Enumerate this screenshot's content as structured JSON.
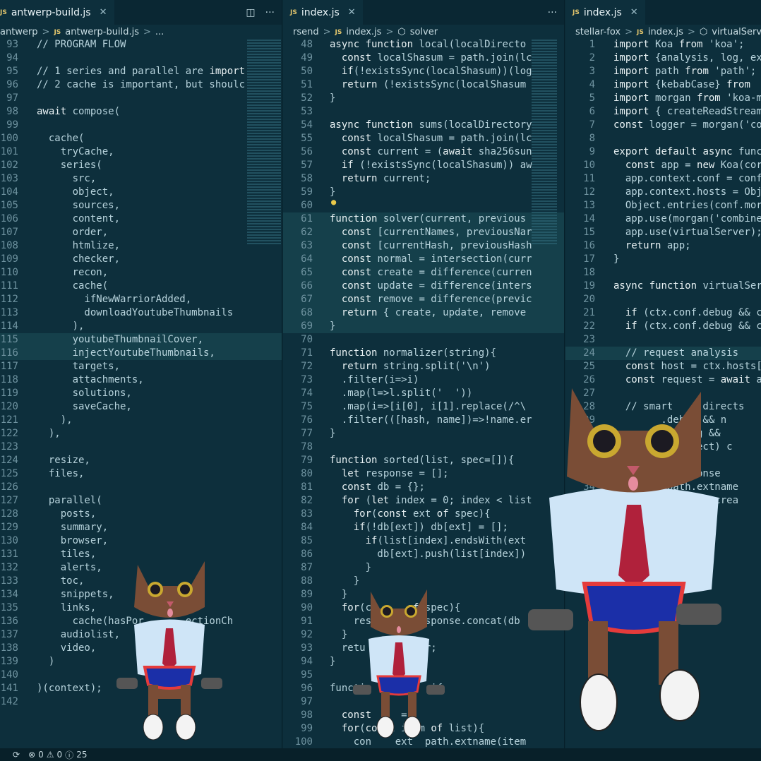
{
  "panes": [
    {
      "tab": "antwerp-build.js",
      "crumbs": [
        "antwerp",
        "antwerp-build.js",
        "..."
      ],
      "start": 93,
      "lines": [
        "// PROGRAM FLOW",
        "",
        "// 1 series and parallel are import",
        "// 2 cache is important, but shoulc",
        "",
        "await compose(",
        "",
        "  cache(",
        "    tryCache,",
        "    series(",
        "      src,",
        "      object,",
        "      sources,",
        "      content,",
        "      order,",
        "      htmlize,",
        "      checker,",
        "      recon,",
        "      cache(",
        "        ifNewWarriorAdded,",
        "        downloadYoutubeThumbnails",
        "      ),",
        "      youtubeThumbnailCover,",
        "      injectYoutubeThumbnails,",
        "      targets,",
        "      attachments,",
        "      solutions,",
        "      saveCache,",
        "    ),",
        "  ),",
        "",
        "  resize,",
        "  files,",
        "",
        "  parallel(",
        "    posts,",
        "    summary,",
        "    browser,",
        "    tiles,",
        "    alerts,",
        "    toc,",
        "    snippets,",
        "    links,",
        "      cache(hasPor       ectionCh",
        "    audiolist,",
        "    video,",
        "  )",
        "",
        ")(context);",
        ""
      ]
    },
    {
      "tab": "index.js",
      "crumbs": [
        "rsend",
        "index.js",
        "solver"
      ],
      "start": 48,
      "lines": [
        "async function local(localDirecto",
        "  const localShasum = path.join(lc",
        "  if(!existsSync(localShasum))(log",
        "  return (!existsSync(localShasum",
        "}",
        "",
        "async function sums(localDirectory",
        "  const localShasum = path.join(lc",
        "  const current = (await sha256sun",
        "  if (!existsSync(localShasum)) aw",
        "  return current;",
        "}",
        "",
        "function solver(current, previous",
        "  const [currentNames, previousNar",
        "  const [currentHash, previousHash",
        "  const normal = intersection(curr",
        "  const create = difference(curren",
        "  const update = difference(inters",
        "  const remove = difference(previc",
        "  return { create, update, remove",
        "}",
        "",
        "function normalizer(string){",
        "  return string.split('\\n')",
        "  .filter(i=>i)",
        "  .map(l=>l.split('  '))",
        "  .map(i=>[i[0], i[1].replace(/^\\",
        "  .filter(([hash, name])=>!name.er",
        "}",
        "",
        "function sorted(list, spec=[]){",
        "  let response = [];",
        "  const db = {};",
        "  for (let index = 0; index < list",
        "    for(const ext of spec){",
        "    if(!db[ext]) db[ext] = [];",
        "      if(list[index].endsWith(ext",
        "        db[ext].push(list[index])",
        "      }",
        "    }",
        "  }",
        "  for(c      of spec){",
        "    resp      response.concat(db",
        "  }",
        "  retu       lver;",
        "}",
        "",
        "functi           i{",
        "",
        "  const     =",
        "  for(const item of list){",
        "    con    ext  path.extname(item"
      ]
    },
    {
      "tab": "index.js",
      "crumbs": [
        "stellar-fox",
        "index.js",
        "virtualServe"
      ],
      "start": 1,
      "lines": [
        "import Koa from 'koa';",
        "import {analysis, log, ex",
        "import path from 'path';",
        "import {kebabCase} from",
        "import morgan from 'koa-m",
        "import { createReadStream",
        "const logger = morgan('co",
        "",
        "export default async func",
        "  const app = new Koa(cor",
        "  app.context.conf = conf",
        "  app.context.hosts = Obj",
        "  Object.entries(conf.mor",
        "  app.use(morgan('combine",
        "  app.use(virtualServer);",
        "  return app;",
        "}",
        "",
        "async function virtualServ",
        "",
        "  if (ctx.conf.debug && c",
        "  if (ctx.conf.debug && c",
        "",
        "  // request analysis",
        "  const host = ctx.hosts[",
        "  const request = await a",
        "",
        "  // smart     directs",
        "        .debug && n",
        "        f.debug &&",
        "         redirect) c",
        "",
        "          response",
        "         path.extname",
        "        Stream = crea",
        "         rror',(",
        "          ream;"
      ]
    }
  ],
  "status": {
    "errors": "0",
    "warnings": "0",
    "info": "25"
  },
  "cats": [
    {
      "label": "cat-left"
    },
    {
      "label": "cat-middle"
    },
    {
      "label": "cat-right"
    }
  ]
}
